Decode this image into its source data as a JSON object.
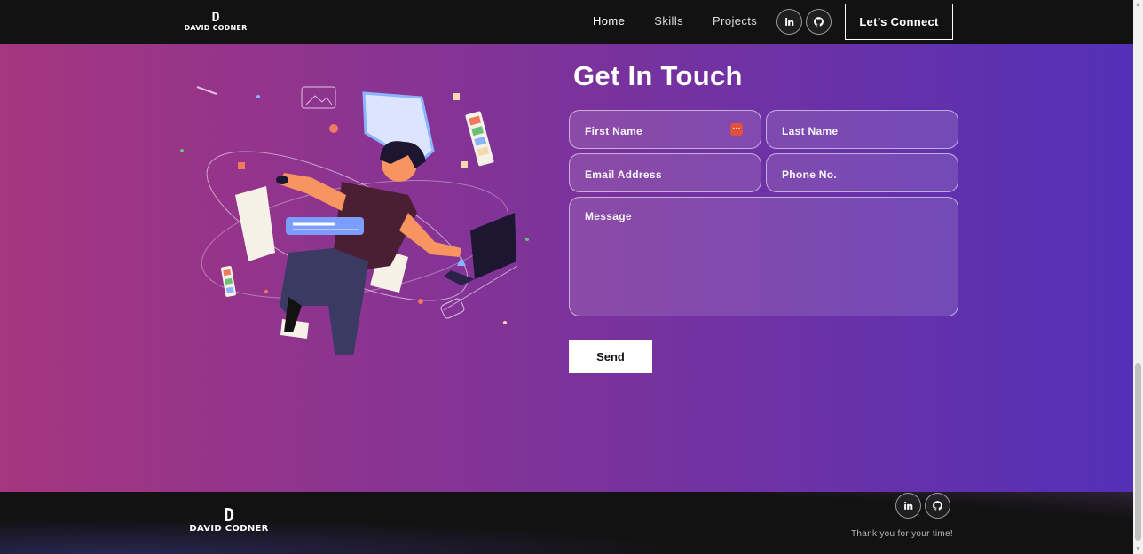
{
  "navbar": {
    "logo": {
      "letter": "D",
      "name": "DAVID CODNER"
    },
    "links": [
      {
        "label": "Home"
      },
      {
        "label": "Skills"
      },
      {
        "label": "Projects"
      }
    ],
    "social_icons": [
      "linkedin-icon",
      "github-icon"
    ],
    "connect_label": "Let’s Connect"
  },
  "contact": {
    "title": "Get In Touch",
    "fields": {
      "first_name": "First Name",
      "last_name": "Last Name",
      "email": "Email Address",
      "phone": "Phone No.",
      "message": "Message"
    },
    "send_label": "Send",
    "gradient_colors": [
      "#aa367c",
      "#4a2fbd"
    ]
  },
  "footer": {
    "logo": {
      "letter": "D",
      "name": "DAVID CODNER"
    },
    "social_icons": [
      "linkedin-icon",
      "github-icon"
    ],
    "thanks": "Thank you for your time!"
  }
}
